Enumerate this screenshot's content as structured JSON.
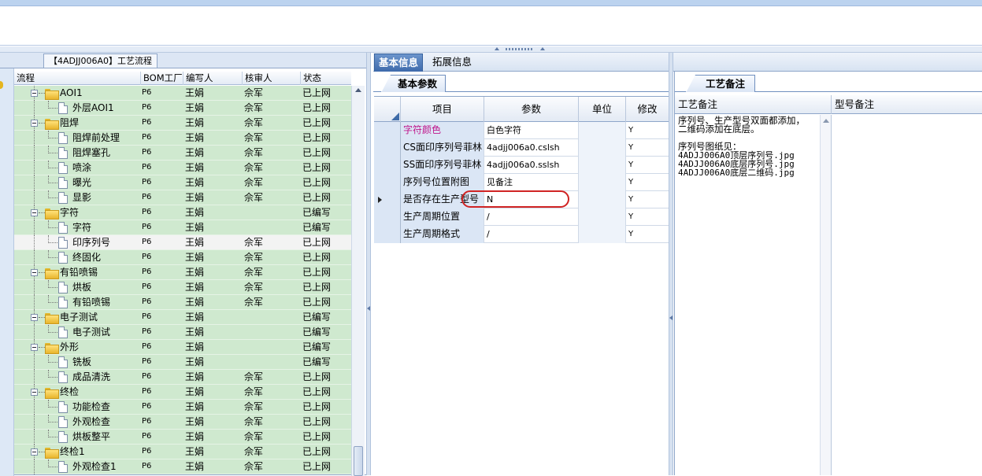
{
  "left_panel": {
    "title": "【4ADJJ006A0】工艺流程",
    "columns": [
      "流程",
      "BOM工厂",
      "编写人",
      "核审人",
      "状态"
    ],
    "rows": [
      {
        "name": "AOI1",
        "level": 1,
        "type": "folder",
        "bom": "P6",
        "writer": "王娟",
        "reviewer": "佘军",
        "status": "已上网"
      },
      {
        "name": "外层AOI1",
        "level": 2,
        "type": "doc",
        "bom": "P6",
        "writer": "王娟",
        "reviewer": "佘军",
        "status": "已上网"
      },
      {
        "name": "阻焊",
        "level": 1,
        "type": "folder",
        "bom": "P6",
        "writer": "王娟",
        "reviewer": "佘军",
        "status": "已上网"
      },
      {
        "name": "阻焊前处理",
        "level": 2,
        "type": "doc",
        "bom": "P6",
        "writer": "王娟",
        "reviewer": "佘军",
        "status": "已上网"
      },
      {
        "name": "阻焊塞孔",
        "level": 2,
        "type": "doc",
        "bom": "P6",
        "writer": "王娟",
        "reviewer": "佘军",
        "status": "已上网"
      },
      {
        "name": "喷涂",
        "level": 2,
        "type": "doc",
        "bom": "P6",
        "writer": "王娟",
        "reviewer": "佘军",
        "status": "已上网"
      },
      {
        "name": "曝光",
        "level": 2,
        "type": "doc",
        "bom": "P6",
        "writer": "王娟",
        "reviewer": "佘军",
        "status": "已上网"
      },
      {
        "name": "显影",
        "level": 2,
        "type": "doc",
        "bom": "P6",
        "writer": "王娟",
        "reviewer": "佘军",
        "status": "已上网"
      },
      {
        "name": "字符",
        "level": 1,
        "type": "folder",
        "bom": "P6",
        "writer": "王娟",
        "reviewer": "",
        "status": "已编写"
      },
      {
        "name": "字符",
        "level": 2,
        "type": "doc",
        "bom": "P6",
        "writer": "王娟",
        "reviewer": "",
        "status": "已编写"
      },
      {
        "name": "印序列号",
        "level": 2,
        "type": "doc",
        "bom": "P6",
        "writer": "王娟",
        "reviewer": "佘军",
        "status": "已上网",
        "selected": true
      },
      {
        "name": "终固化",
        "level": 2,
        "type": "doc",
        "bom": "P6",
        "writer": "王娟",
        "reviewer": "佘军",
        "status": "已上网"
      },
      {
        "name": "有铅喷锡",
        "level": 1,
        "type": "folder",
        "bom": "P6",
        "writer": "王娟",
        "reviewer": "佘军",
        "status": "已上网"
      },
      {
        "name": "烘板",
        "level": 2,
        "type": "doc",
        "bom": "P6",
        "writer": "王娟",
        "reviewer": "佘军",
        "status": "已上网"
      },
      {
        "name": "有铅喷锡",
        "level": 2,
        "type": "doc",
        "bom": "P6",
        "writer": "王娟",
        "reviewer": "佘军",
        "status": "已上网"
      },
      {
        "name": "电子测试",
        "level": 1,
        "type": "folder",
        "bom": "P6",
        "writer": "王娟",
        "reviewer": "",
        "status": "已编写"
      },
      {
        "name": "电子测试",
        "level": 2,
        "type": "doc",
        "bom": "P6",
        "writer": "王娟",
        "reviewer": "",
        "status": "已编写"
      },
      {
        "name": "外形",
        "level": 1,
        "type": "folder",
        "bom": "P6",
        "writer": "王娟",
        "reviewer": "",
        "status": "已编写"
      },
      {
        "name": "铣板",
        "level": 2,
        "type": "doc",
        "bom": "P6",
        "writer": "王娟",
        "reviewer": "",
        "status": "已编写"
      },
      {
        "name": "成品清洗",
        "level": 2,
        "type": "doc",
        "bom": "P6",
        "writer": "王娟",
        "reviewer": "佘军",
        "status": "已上网"
      },
      {
        "name": "终检",
        "level": 1,
        "type": "folder",
        "bom": "P6",
        "writer": "王娟",
        "reviewer": "佘军",
        "status": "已上网"
      },
      {
        "name": "功能检查",
        "level": 2,
        "type": "doc",
        "bom": "P6",
        "writer": "王娟",
        "reviewer": "佘军",
        "status": "已上网"
      },
      {
        "name": "外观检查",
        "level": 2,
        "type": "doc",
        "bom": "P6",
        "writer": "王娟",
        "reviewer": "佘军",
        "status": "已上网"
      },
      {
        "name": "烘板整平",
        "level": 2,
        "type": "doc",
        "bom": "P6",
        "writer": "王娟",
        "reviewer": "佘军",
        "status": "已上网"
      },
      {
        "name": "终检1",
        "level": 1,
        "type": "folder",
        "bom": "P6",
        "writer": "王娟",
        "reviewer": "佘军",
        "status": "已上网"
      },
      {
        "name": "外观检查1",
        "level": 2,
        "type": "doc",
        "bom": "P6",
        "writer": "王娟",
        "reviewer": "佘军",
        "status": "已上网"
      }
    ]
  },
  "tabs": {
    "basic_info": "基本信息",
    "extended_info": "拓展信息"
  },
  "basic_params": {
    "tab_label": "基本参数",
    "columns": {
      "item": "项目",
      "param": "参数",
      "unit": "单位",
      "modify": "修改"
    },
    "rows": [
      {
        "item": "字符颜色",
        "param": "白色字符",
        "unit": "",
        "modify": "Y",
        "item_color": "#c0168c"
      },
      {
        "item": "CS面印序列号菲林",
        "param": "4adjj006a0.cslsh",
        "unit": "",
        "modify": "Y"
      },
      {
        "item": "SS面印序列号菲林",
        "param": "4adjj006a0.sslsh",
        "unit": "",
        "modify": "Y"
      },
      {
        "item": "序列号位置附图",
        "param": "见备注",
        "unit": "",
        "modify": "Y"
      },
      {
        "item": "是否存在生产型号",
        "param": "N",
        "unit": "",
        "modify": "Y",
        "current": true
      },
      {
        "item": "生产周期位置",
        "param": "/",
        "unit": "",
        "modify": "Y"
      },
      {
        "item": "生产周期格式",
        "param": "/",
        "unit": "",
        "modify": "Y"
      }
    ]
  },
  "process_remarks": {
    "tab_label": "工艺备注",
    "col_remark": "工艺备注",
    "col_model_remark": "型号备注",
    "lines": [
      "序列号、生产型号双面都添加，",
      "二维码添加在底层。",
      "",
      "序列号图纸见：",
      "4ADJJ006A0顶层序列号.jpg",
      "4ADJJ006A0底层序列号.jpg",
      "4ADJJ006A0底层二维码.jpg"
    ]
  },
  "colors": {
    "tree_row_bg": "#cfe9cf",
    "accent_tab": "#3e6aab",
    "highlight": "#d02424"
  }
}
